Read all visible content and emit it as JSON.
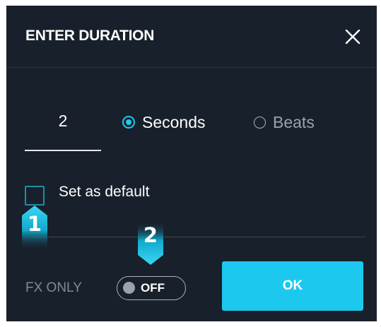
{
  "dialog": {
    "title": "ENTER DURATION",
    "close_icon": "close-icon"
  },
  "duration": {
    "value": "2"
  },
  "unit": {
    "selected": "Seconds",
    "options": [
      {
        "label": "Seconds",
        "selected": true
      },
      {
        "label": "Beats",
        "selected": false
      }
    ]
  },
  "default_checkbox": {
    "label": "Set as default",
    "checked": false
  },
  "markers": [
    {
      "number": "1"
    },
    {
      "number": "2"
    }
  ],
  "fx_only": {
    "label": "FX ONLY",
    "toggle_state": "OFF"
  },
  "ok_button": {
    "label": "OK"
  },
  "colors": {
    "background": "#18202b",
    "accent": "#1dc8ef",
    "muted_text": "#828a96"
  }
}
